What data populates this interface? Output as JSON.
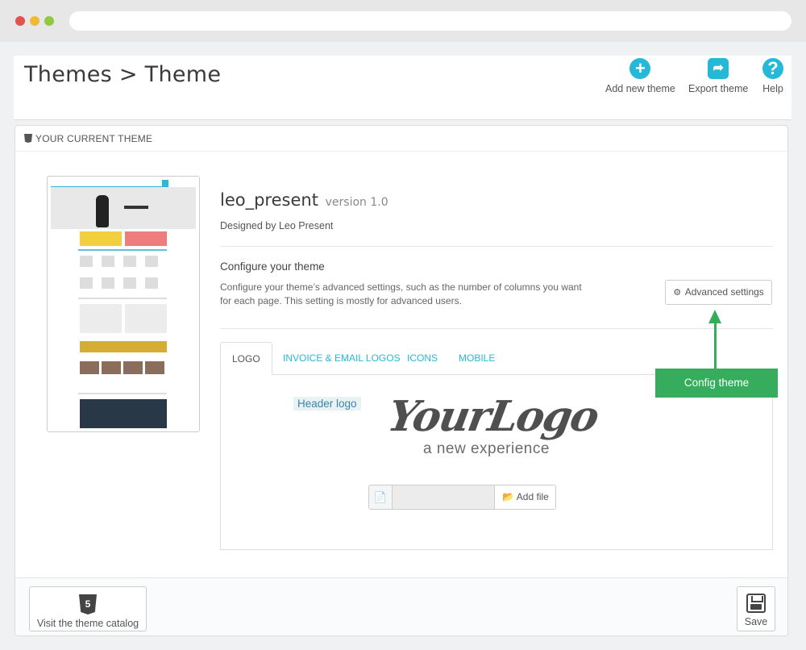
{
  "header": {
    "title": "Themes > Theme",
    "toolbar": [
      {
        "label": "Add new theme",
        "icon": "plus-circle-icon"
      },
      {
        "label": "Export theme",
        "icon": "share-icon"
      },
      {
        "label": "Help",
        "icon": "question-circle-icon"
      }
    ]
  },
  "panel": {
    "heading": "YOUR CURRENT THEME",
    "theme": {
      "name": "leo_present",
      "version": "version 1.0",
      "designed_by": "Designed by Leo Present"
    },
    "configure": {
      "title": "Configure your theme",
      "description": "Configure your theme’s advanced settings, such as the number of columns you want for each page. This setting is mostly for advanced users.",
      "button": "Advanced settings"
    },
    "tabs": [
      {
        "label": "LOGO",
        "active": true
      },
      {
        "label": "INVOICE & EMAIL LOGOS",
        "active": false
      },
      {
        "label": "ICONS",
        "active": false
      },
      {
        "label": "MOBILE",
        "active": false
      }
    ],
    "logo_tab": {
      "label": "Header logo",
      "logo_main": "YourLogo",
      "logo_sub": "a new experience",
      "add_file": "Add file"
    },
    "callout": "Config theme",
    "footer": {
      "catalog_button": "Visit the theme catalog",
      "save_button": "Save"
    }
  },
  "colors": {
    "accent": "#25b9d7",
    "callout": "#36ad5c"
  }
}
